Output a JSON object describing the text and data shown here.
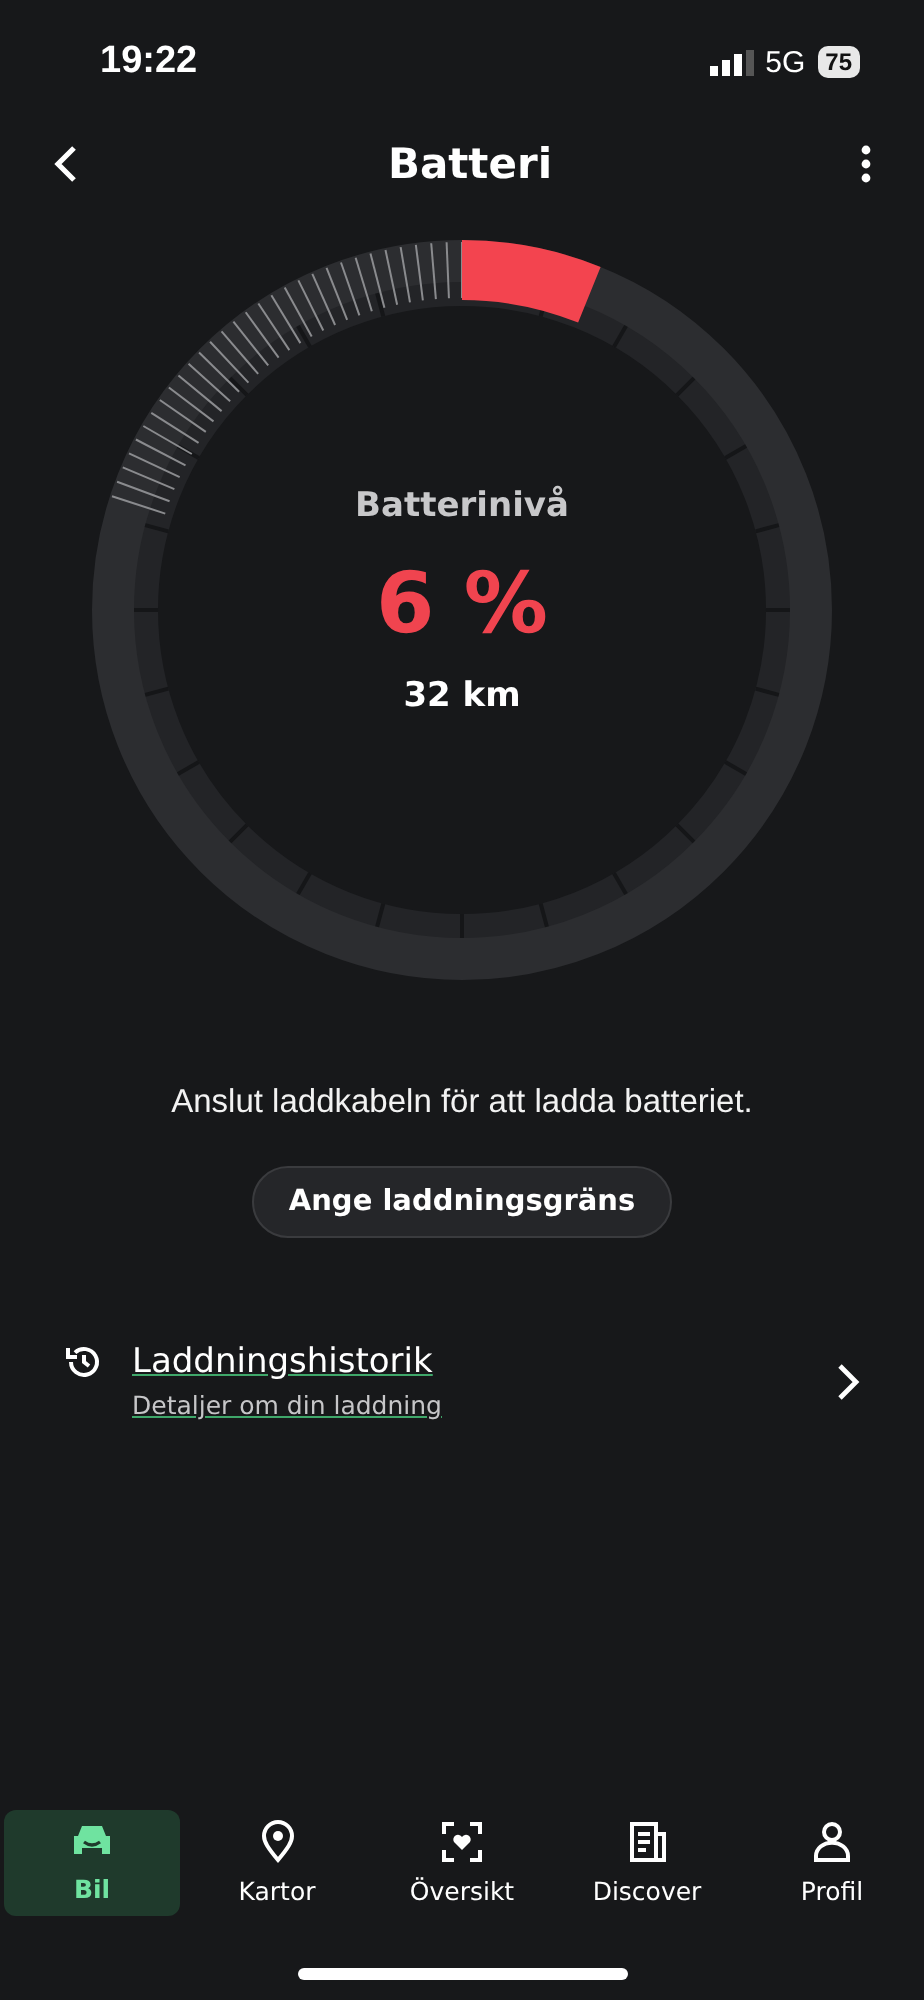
{
  "status_bar": {
    "time": "19:22",
    "network": "5G",
    "battery": "75"
  },
  "header": {
    "title": "Batteri"
  },
  "gauge": {
    "label": "Batterinivå",
    "percent": "6 %",
    "range": "32 km"
  },
  "message": "Anslut laddkabeln för att ladda batteriet.",
  "limit_button": "Ange laddningsgräns",
  "history": {
    "title": "Laddningshistorik",
    "subtitle": "Detaljer om din laddning"
  },
  "nav": [
    {
      "kind": "car",
      "label": "Bil",
      "selected": true
    },
    {
      "kind": "pin",
      "label": "Kartor",
      "selected": false
    },
    {
      "kind": "overview",
      "label": "Översikt",
      "selected": false
    },
    {
      "kind": "news",
      "label": "Discover",
      "selected": false
    },
    {
      "kind": "person",
      "label": "Profil",
      "selected": false
    }
  ]
}
